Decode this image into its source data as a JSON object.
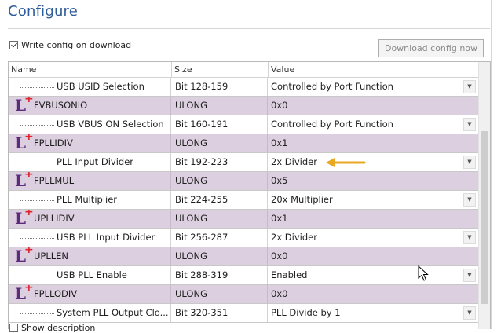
{
  "page": {
    "title": "Configure"
  },
  "options": {
    "write_config_label": "Write config on download",
    "write_config_checked": true,
    "download_button_label": "Download config now",
    "bottom_checkbox_label": "Show description"
  },
  "grid": {
    "columns": [
      "Name",
      "Size",
      "Value"
    ],
    "rows": [
      {
        "kind": "field",
        "name": "USB USID Selection",
        "size": "Bit 128-159",
        "value": "Controlled by Port Function",
        "dropdown": true
      },
      {
        "kind": "register",
        "name": "FVBUSONIO",
        "size": "ULONG",
        "value": "0x0"
      },
      {
        "kind": "field",
        "name": "USB VBUS ON Selection",
        "size": "Bit 160-191",
        "value": "Controlled by Port Function",
        "dropdown": true
      },
      {
        "kind": "register",
        "name": "FPLLIDIV",
        "size": "ULONG",
        "value": "0x1"
      },
      {
        "kind": "field",
        "name": "PLL Input Divider",
        "size": "Bit 192-223",
        "value": "2x Divider",
        "dropdown": true
      },
      {
        "kind": "register",
        "name": "FPLLMUL",
        "size": "ULONG",
        "value": "0x5"
      },
      {
        "kind": "field",
        "name": "PLL Multiplier",
        "size": "Bit 224-255",
        "value": "20x Multiplier",
        "dropdown": true
      },
      {
        "kind": "register",
        "name": "UPLLIDIV",
        "size": "ULONG",
        "value": "0x1"
      },
      {
        "kind": "field",
        "name": "USB PLL Input Divider",
        "size": "Bit 256-287",
        "value": "2x Divider",
        "dropdown": true
      },
      {
        "kind": "register",
        "name": "UPLLEN",
        "size": "ULONG",
        "value": "0x0"
      },
      {
        "kind": "field",
        "name": "USB PLL Enable",
        "size": "Bit 288-319",
        "value": "Enabled",
        "dropdown": true
      },
      {
        "kind": "register",
        "name": "FPLLODIV",
        "size": "ULONG",
        "value": "0x0"
      },
      {
        "kind": "field",
        "name": "System PLL Output Clo...",
        "size": "Bit 320-351",
        "value": "PLL Divide by 1",
        "dropdown": true
      }
    ]
  },
  "colors": {
    "register_row_bg": "#dccfdf",
    "register_icon": "#5b2c7a",
    "register_plus": "#e0222a",
    "title_blue": "#2f5d9c",
    "annotation_arrow": "#e8a820"
  },
  "icons": {
    "register": "register-L-plus-icon",
    "dropdown": "chevron-down-icon",
    "annotation": "arrow-left-icon",
    "cursor": "mouse-pointer-icon"
  }
}
